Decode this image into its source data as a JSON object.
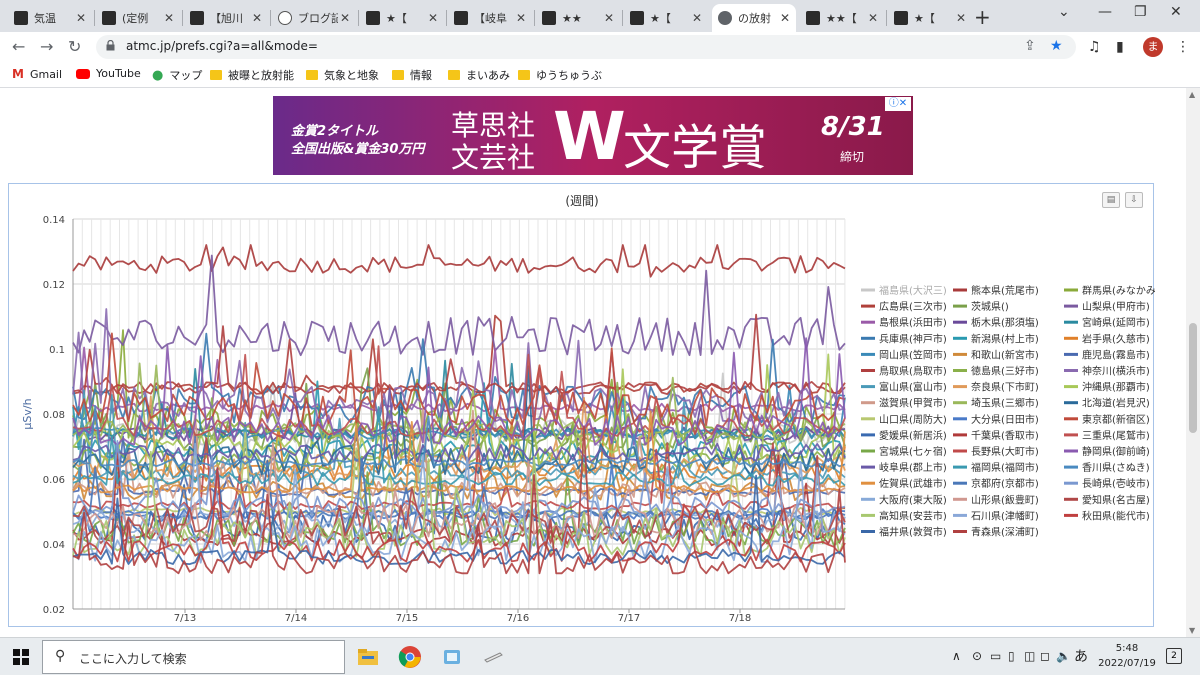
{
  "tabs": [
    {
      "title": "気温"
    },
    {
      "title": "(定例"
    },
    {
      "title": "【旭川"
    },
    {
      "title": "ブログ記"
    },
    {
      "title": "★【"
    },
    {
      "title": "【岐阜"
    },
    {
      "title": "★★"
    },
    {
      "title": "★【"
    },
    {
      "title": "の放射",
      "active": true
    },
    {
      "title": "★★【"
    },
    {
      "title": "★【"
    }
  ],
  "address": {
    "url": "atmc.jp/prefs.cgi?a=all&mode="
  },
  "profile": {
    "initial": "ま"
  },
  "bookmarks": [
    {
      "label": "Gmail",
      "icon": "gmail-icon"
    },
    {
      "label": "YouTube",
      "icon": "youtube-icon"
    },
    {
      "label": "マップ",
      "icon": "maps-icon"
    },
    {
      "label": "被曝と放射能",
      "icon": "folder-icon"
    },
    {
      "label": "気象と地象",
      "icon": "folder-icon"
    },
    {
      "label": "情報",
      "icon": "folder-icon"
    },
    {
      "label": "まいあみ",
      "icon": "folder-icon"
    },
    {
      "label": "ゆうちゅうぶ",
      "icon": "folder-icon"
    }
  ],
  "ad": {
    "line1": "金賞2タイトル",
    "line2": "全国出版&賞金30万円",
    "publisher1": "草思社",
    "publisher2": "文芸社",
    "w": "W",
    "award": "文学賞",
    "date": "8/31",
    "deadline": "締切"
  },
  "chart_data": {
    "type": "line",
    "title": "(週間)",
    "ylabel": "μSv/h",
    "xlabel": "",
    "ylim": [
      0.02,
      0.14
    ],
    "yticks": [
      "0.02",
      "0.04",
      "0.06",
      "0.08",
      "0.1",
      "0.12",
      "0.14"
    ],
    "xticks": [
      "7/13",
      "7/14",
      "7/15",
      "7/16",
      "7/17",
      "7/18"
    ],
    "grid": true,
    "legend_position": "right",
    "legend": [
      {
        "name": "福島県(大沢三)",
        "color": "#c8c8c8"
      },
      {
        "name": "熊本県(荒尾市)",
        "color": "#a83a3a"
      },
      {
        "name": "群馬県(みなかみ)",
        "color": "#8aaa3a"
      },
      {
        "name": "広島県(三次市)",
        "color": "#b0403a"
      },
      {
        "name": "茨城県()",
        "color": "#7aa04a"
      },
      {
        "name": "山梨県(甲府市)",
        "color": "#7a5aa0"
      },
      {
        "name": "島根県(浜田市)",
        "color": "#9a5aa8"
      },
      {
        "name": "栃木県(那須塩)",
        "color": "#6a4a9a"
      },
      {
        "name": "宮崎県(延岡市)",
        "color": "#2a8aa0"
      },
      {
        "name": "兵庫県(神戸市)",
        "color": "#3a7ab0"
      },
      {
        "name": "新潟県(村上市)",
        "color": "#2a9ab0"
      },
      {
        "name": "岩手県(久慈市)",
        "color": "#e0802a"
      },
      {
        "name": "岡山県(笠岡市)",
        "color": "#3a8ab8"
      },
      {
        "name": "和歌山(新宮市)",
        "color": "#d08a3a"
      },
      {
        "name": "鹿児島(霧島市)",
        "color": "#4a6ab0"
      },
      {
        "name": "鳥取県(鳥取市)",
        "color": "#b04040"
      },
      {
        "name": "徳島県(三好市)",
        "color": "#8ab04a"
      },
      {
        "name": "神奈川(横浜市)",
        "color": "#8a6ab0"
      },
      {
        "name": "富山県(富山市)",
        "color": "#4a9ab8"
      },
      {
        "name": "奈良県(下市町)",
        "color": "#e09a5a"
      },
      {
        "name": "沖縄県(那覇市)",
        "color": "#a8c858"
      },
      {
        "name": "滋賀県(甲賀市)",
        "color": "#d09a8a"
      },
      {
        "name": "埼玉県(三郷市)",
        "color": "#9ab85a"
      },
      {
        "name": "北海道(岩見沢)",
        "color": "#2a6a9a"
      },
      {
        "name": "山口県(周防大)",
        "color": "#b8c870"
      },
      {
        "name": "大分県(日田市)",
        "color": "#4a7ac8"
      },
      {
        "name": "東京都(新宿区)",
        "color": "#c04a3a"
      },
      {
        "name": "愛媛県(新居浜)",
        "color": "#3a6ab0"
      },
      {
        "name": "千葉県(香取市)",
        "color": "#b03a3a"
      },
      {
        "name": "三重県(尾鷲市)",
        "color": "#c05050"
      },
      {
        "name": "宮城県(七ヶ宿)",
        "color": "#78a848"
      },
      {
        "name": "長野県(大町市)",
        "color": "#c04a4a"
      },
      {
        "name": "静岡県(御前崎)",
        "color": "#8a5ab0"
      },
      {
        "name": "岐阜県(郡上市)",
        "color": "#6a5aa8"
      },
      {
        "name": "福岡県(福岡市)",
        "color": "#3a9ab0"
      },
      {
        "name": "香川県(さぬき)",
        "color": "#4a8ac0"
      },
      {
        "name": "佐賀県(武雄市)",
        "color": "#e09040"
      },
      {
        "name": "京都府(京都市)",
        "color": "#4a78b8"
      },
      {
        "name": "長崎県(壱岐市)",
        "color": "#7a98d0"
      },
      {
        "name": "大阪府(東大阪)",
        "color": "#88aad8"
      },
      {
        "name": "山形県(飯豊町)",
        "color": "#d09890"
      },
      {
        "name": "愛知県(名古屋)",
        "color": "#b04848"
      },
      {
        "name": "高知県(安芸市)",
        "color": "#a8c870"
      },
      {
        "name": "石川県(津幡町)",
        "color": "#8aa8d8"
      },
      {
        "name": "秋田県(能代市)",
        "color": "#c04040"
      },
      {
        "name": "福井県(敦賀市)",
        "color": "#3a68a8"
      },
      {
        "name": "青森県(深浦町)",
        "color": "#b04040"
      }
    ],
    "series_summary": [
      {
        "name": "熊本県(荒尾市)",
        "approx_range": [
          0.08,
          0.13
        ]
      },
      {
        "name": "栃木県(那須塩)",
        "approx_range": [
          0.104,
          0.116
        ]
      },
      {
        "name": "福井県(敦賀市)",
        "approx_range": [
          0.033,
          0.04
        ]
      }
    ]
  },
  "taskbar": {
    "search_placeholder": "ここに入力して検索",
    "time": "5:48",
    "date": "2022/07/19",
    "ime": "あ",
    "notifications": "2"
  }
}
